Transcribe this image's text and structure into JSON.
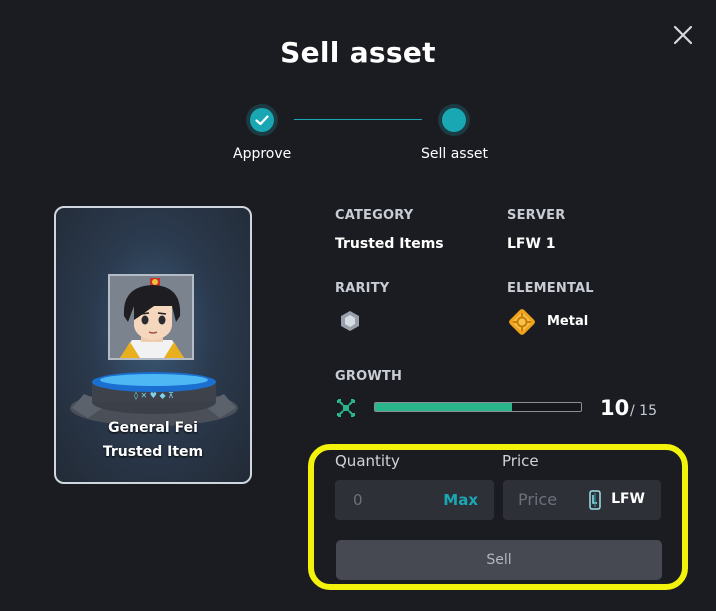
{
  "modal": {
    "title": "Sell asset"
  },
  "steps": [
    {
      "label": "Approve",
      "done": true
    },
    {
      "label": "Sell asset",
      "done": false
    }
  ],
  "card": {
    "name": "General Fei",
    "type": "Trusted Item"
  },
  "info": {
    "category_label": "CATEGORY",
    "category_value": "Trusted Items",
    "server_label": "SERVER",
    "server_value": "LFW 1",
    "rarity_label": "RARITY",
    "elemental_label": "ELEMENTAL",
    "elemental_value": "Metal",
    "growth_label": "GROWTH",
    "growth_value": "10",
    "growth_max": "/ 15",
    "growth_fraction": 0.667
  },
  "form": {
    "quantity_label": "Quantity",
    "quantity_value": "0",
    "max_label": "Max",
    "price_label": "Price",
    "price_placeholder": "Price",
    "currency": "LFW",
    "sell_label": "Sell"
  },
  "colors": {
    "accent": "#1aa7b4",
    "growth": "#2bb58a",
    "highlight": "#f2f20b",
    "background": "#1b1c22"
  }
}
